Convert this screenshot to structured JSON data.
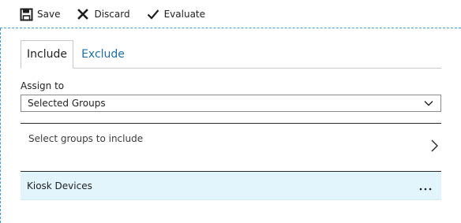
{
  "toolbar": {
    "save_label": "Save",
    "discard_label": "Discard",
    "evaluate_label": "Evaluate"
  },
  "tabs": [
    {
      "label": "Include",
      "selected": true
    },
    {
      "label": "Exclude",
      "selected": false
    }
  ],
  "assign": {
    "label": "Assign to",
    "selected_value": "Selected Groups"
  },
  "groups_picker": {
    "label": "Select groups to include"
  },
  "selected_groups": [
    {
      "name": "Kiosk Devices"
    }
  ],
  "colors": {
    "accent": "#1a6fb5",
    "selected_row_bg": "#e3f5fc",
    "dashed_border": "#3a9fd6"
  },
  "icons": {
    "save": "save-icon",
    "discard": "close-icon",
    "evaluate": "checkmark-icon",
    "dropdown": "chevron-down-icon",
    "navigate": "chevron-right-icon",
    "more": "more-icon"
  }
}
